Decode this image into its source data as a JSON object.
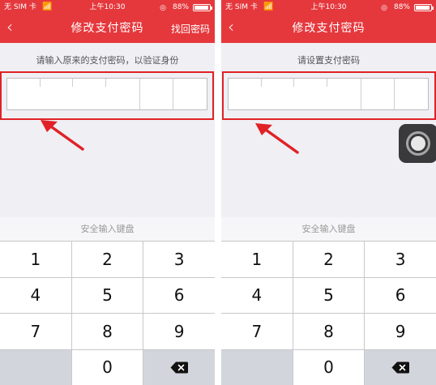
{
  "status_bar": {
    "carrier": "无 SIM 卡",
    "time": "上午10:30",
    "battery": "88%"
  },
  "screens": [
    {
      "back_icon": "‹",
      "title": "修改支付密码",
      "right_link": "找回密码",
      "prompt": "请输入原来的支付密码，以验证身份",
      "keyboard_label": "安全输入键盘"
    },
    {
      "back_icon": "‹",
      "title": "修改支付密码",
      "prompt": "请设置支付密码",
      "keyboard_label": "安全输入键盘"
    }
  ],
  "keypad": {
    "keys": [
      "1",
      "2",
      "3",
      "4",
      "5",
      "6",
      "7",
      "8",
      "9",
      "",
      "0",
      "delete"
    ]
  },
  "colors": {
    "header": "#e5383d",
    "highlight": "#e02226",
    "arrow": "#e02226"
  },
  "icons": {
    "back": "chevron-left-icon",
    "wifi": "wifi-icon",
    "lock": "rotation-lock-icon",
    "battery": "battery-icon",
    "delete": "backspace-icon",
    "assistive": "assistive-touch-icon",
    "arrow": "red-arrow-icon"
  }
}
